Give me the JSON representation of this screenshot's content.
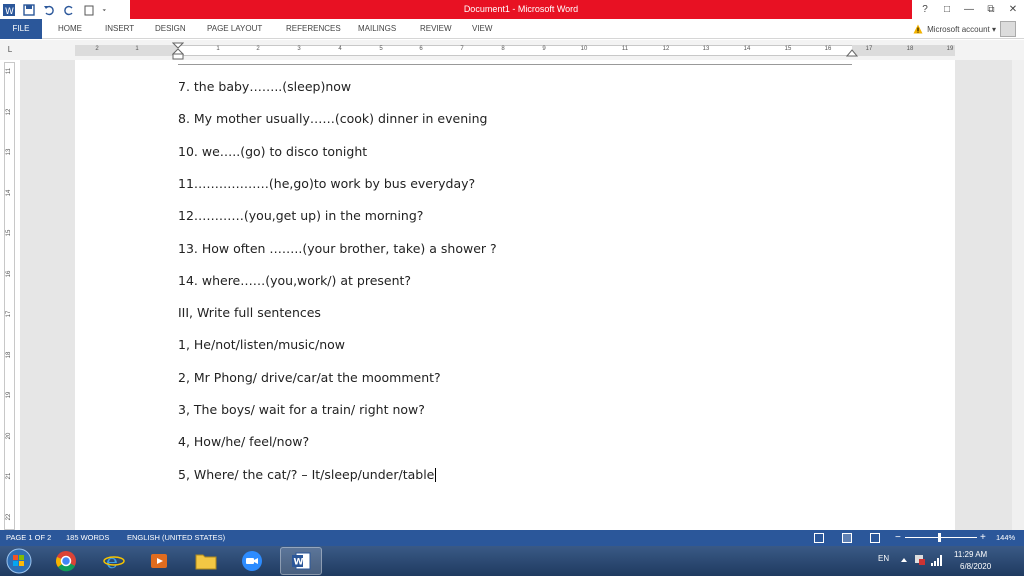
{
  "window": {
    "title": "Document1 - Microsoft Word",
    "controls": [
      "?",
      "□",
      "—",
      "⧉",
      "✕"
    ]
  },
  "ribbon": {
    "file_tab": "FILE",
    "tabs": [
      "HOME",
      "INSERT",
      "DESIGN",
      "PAGE LAYOUT",
      "REFERENCES",
      "MAILINGS",
      "REVIEW",
      "VIEW"
    ],
    "account": "Microsoft account ▾"
  },
  "ruler": {
    "corner": "L",
    "h_numbers": [
      "2",
      "1",
      "1",
      "2",
      "3",
      "4",
      "5",
      "6",
      "7",
      "8",
      "9",
      "10",
      "11",
      "12",
      "13",
      "14",
      "15",
      "16",
      "17",
      "18",
      "19"
    ],
    "v_numbers": [
      "11",
      "12",
      "13",
      "14",
      "15",
      "16",
      "17",
      "18",
      "19",
      "20",
      "21",
      "22"
    ]
  },
  "document": {
    "lines": [
      "7. the baby……..(sleep)now",
      "8. My mother usually……(cook) dinner in evening",
      "10. we…..(go) to disco tonight",
      "11………………(he,go)to work by bus everyday?",
      "12…………(you,get up) in the morning?",
      "13. How often ……..(your brother, take) a shower ?",
      "14. where……(you,work/) at present?",
      "III, Write full sentences",
      "1, He/not/listen/music/now",
      "2, Mr Phong/ drive/car/at the moomment?",
      "3, The boys/ wait for a train/ right now?",
      "4, How/he/ feel/now?",
      "5, Where/ the cat/? – It/sleep/under/table"
    ]
  },
  "status": {
    "page": "PAGE 1 OF 2",
    "words": "185 WORDS",
    "language": "ENGLISH (UNITED STATES)",
    "zoom": "144%",
    "zoom_minus": "−",
    "zoom_plus": "+"
  },
  "taskbar": {
    "apps": [
      "start-orb",
      "chrome",
      "internet-explorer",
      "media-player",
      "file-explorer",
      "zoom",
      "word"
    ],
    "lang": "EN",
    "time": "11:29 AM",
    "date": "6/8/2020"
  },
  "colors": {
    "title_red": "#e81123",
    "word_blue": "#2b579a"
  }
}
